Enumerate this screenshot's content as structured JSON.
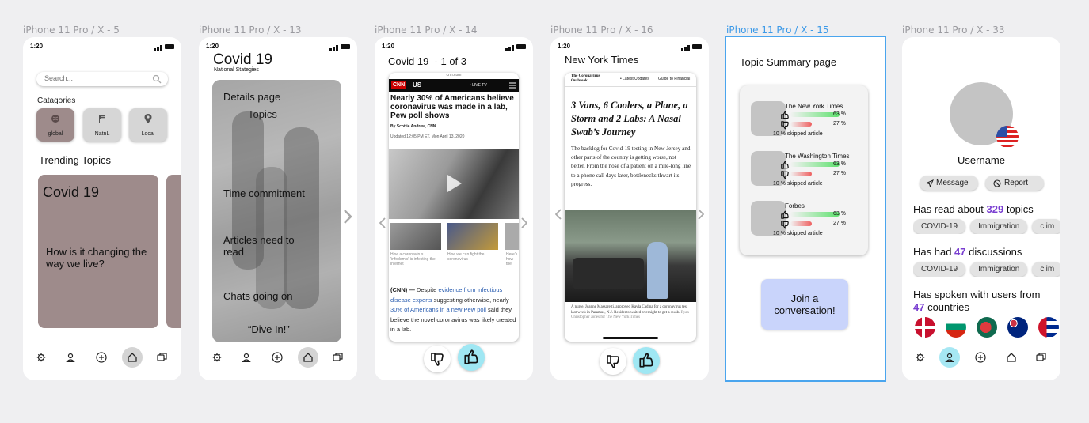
{
  "frames": [
    {
      "label": "iPhone 11 Pro / X - 5"
    },
    {
      "label": "iPhone 11 Pro / X - 13"
    },
    {
      "label": "iPhone 11 Pro / X - 14"
    },
    {
      "label": "iPhone 11 Pro / X - 16"
    },
    {
      "label": "iPhone 11 Pro / X - 15"
    },
    {
      "label": "iPhone 11 Pro / X - 33"
    }
  ],
  "status_time": "1:20",
  "home": {
    "search_placeholder": "Search...",
    "categories_label": "Catagories",
    "categories": [
      {
        "label": "global"
      },
      {
        "label": "NatnL"
      },
      {
        "label": "Local"
      }
    ],
    "trending_label": "Trending Topics",
    "card_title": "Covid 19",
    "card_subtitle": "How is it changing the way we live?"
  },
  "topic": {
    "title": "Covid 19",
    "subtitle": "National Stategies",
    "details": "Details page",
    "topics": "Topics",
    "time": "Time commitment",
    "articles": "Articles need to read",
    "chats": "Chats going on",
    "dive": "“Dive In!”"
  },
  "cnn": {
    "header": "Covid 19  - 1 of 3",
    "url": "cnn.com",
    "logo": "CNN",
    "edition": "US",
    "live": "• LIVE TV",
    "headline": "Nearly 30% of Americans believe coronavirus was made in a lab, Pew poll shows",
    "byline": "By Scottie Andrew, CNN",
    "updated": "Updated 12:05 PM ET, Mon April 13, 2020",
    "thumb1": "How a coronavirus 'infodemic' is infecting the internet",
    "thumb2": "How we can fight the coronavirus",
    "thumb3": "Here's how the coronavirus spreads",
    "body_lead": "(CNN) —",
    "body_1": " Despite ",
    "body_link1": "evidence from infectious disease experts",
    "body_2": " suggesting otherwise, nearly ",
    "body_link2": "30% of Americans in a new Pew poll",
    "body_3": " said they believe the novel coronavirus was likely created in a lab."
  },
  "nyt": {
    "header": "New York Times",
    "section": "The Coronavirus Outbreak",
    "latest": "• Latest Updates",
    "guide": "Guide to Financial",
    "headline": "3 Vans, 6 Coolers, a Plane, a Storm and 2 Labs: A Nasal Swab’s Journey",
    "body": "The backlog for Covid-19 testing in New Jersey and other parts of the country is getting worse, not better. From the nose of a patient on a mile-long line to a phone call days later, bottlenecks thwart its progress.",
    "caption": "A nurse, Joanne Massaretti, approved Kayla Cadina for a coronavirus test last week in Paramus, N.J. Residents waited overnight to get a swab.",
    "credit": "Ryan Christopher Jones for The New York Times"
  },
  "summary": {
    "title": "Topic Summary page",
    "sources": [
      {
        "name": "The New York Times",
        "up": "63 %",
        "down": "27 %",
        "up_frac": 0.63,
        "down_frac": 0.27,
        "skipped": "10 % skipped article"
      },
      {
        "name": "The Washington Times",
        "up": "63 %",
        "down": "27 %",
        "up_frac": 0.63,
        "down_frac": 0.27,
        "skipped": "10 % skipped article"
      },
      {
        "name": "Forbes",
        "up": "63 %",
        "down": "27 %",
        "up_frac": 0.63,
        "down_frac": 0.27,
        "skipped": "10 % skipped article"
      }
    ],
    "join_line1": "Join a",
    "join_line2": "conversation!"
  },
  "profile": {
    "username": "Username",
    "message": "Message",
    "report": "Report",
    "read_prefix": "Has read about ",
    "read_count": "329",
    "read_suffix": " topics",
    "disc_prefix": "Has had ",
    "disc_count": "47",
    "disc_suffix": " discussions",
    "spoken_line": "Has spoken with users from",
    "countries_count": "47",
    "countries_suffix": " countries",
    "tags": [
      "COVID-19",
      "Immigration",
      "clim"
    ],
    "accent": "#7a3fd1"
  }
}
